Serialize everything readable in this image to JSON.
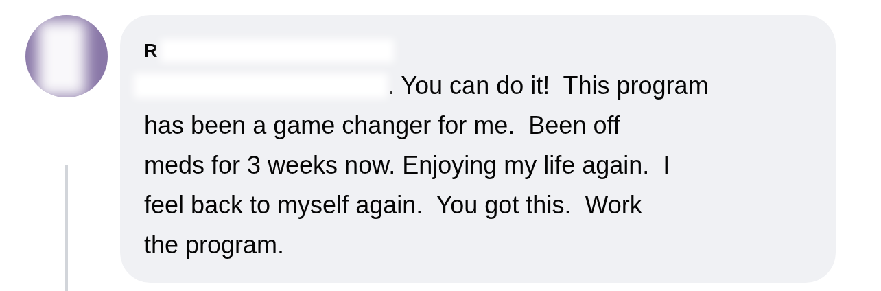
{
  "comment": {
    "author": "R",
    "lines": [
      ". You can do it!  This program",
      "has been a game changer for me.  Been off",
      "meds for 3 weeks now. Enjoying my life again.  I",
      "feel back to myself again.  You got this.  Work",
      "the program."
    ]
  }
}
